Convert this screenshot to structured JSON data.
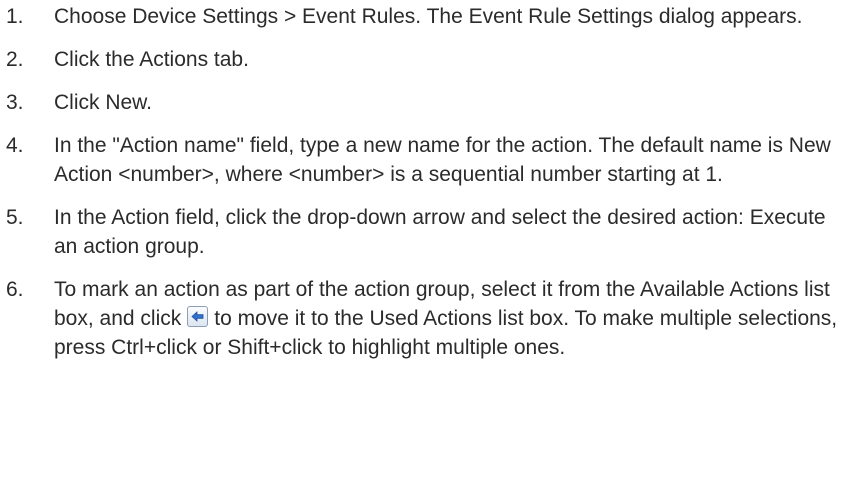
{
  "steps": [
    {
      "number": "1.",
      "text": "Choose Device Settings > Event Rules. The Event Rule Settings dialog appears."
    },
    {
      "number": "2.",
      "text": "Click the Actions tab."
    },
    {
      "number": "3.",
      "text": "Click New."
    },
    {
      "number": "4.",
      "text": "In the \"Action name\" field, type a new name for the action. The default name is New Action <number>, where <number> is a sequential number starting at 1."
    },
    {
      "number": "5.",
      "text": "In the Action field, click the drop-down arrow and select the desired action: Execute an action group."
    },
    {
      "number": "6.",
      "text_before_icon": "To mark an action as part of the action group, select it from the Available Actions list box, and click",
      "icon": "move-left-arrow-icon",
      "text_after_icon": "to move it to the Used Actions list box. To make multiple selections, press Ctrl+click or Shift+click to highlight multiple ones."
    }
  ],
  "colors": {
    "text": "#2b2b2b",
    "icon_arrow": "#2f6fd0",
    "icon_border": "#8c9db5"
  }
}
